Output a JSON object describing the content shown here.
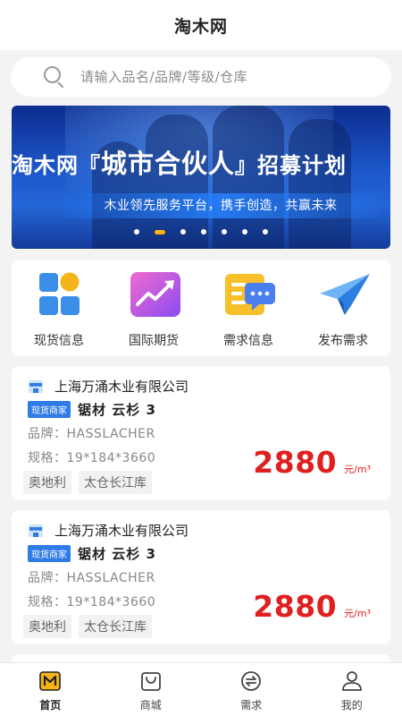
{
  "header": {
    "title": "淘木网"
  },
  "search": {
    "placeholder": "请输入品名/品牌/等级/仓库"
  },
  "banner": {
    "headline_a": "淘木网『",
    "headline_b": "城市合伙人",
    "headline_c": "』招募计划",
    "subline": "木业领先服务平台，携手创造，共赢未来",
    "slides": 7,
    "active_slide": 2
  },
  "menu": [
    {
      "label": "现货信息",
      "icon": "grid-icon"
    },
    {
      "label": "国际期货",
      "icon": "trend-chart-icon"
    },
    {
      "label": "需求信息",
      "icon": "message-card-icon"
    },
    {
      "label": "发布需求",
      "icon": "paper-plane-icon"
    }
  ],
  "listings": [
    {
      "company": "上海万涌木业有限公司",
      "tag": "现货商家",
      "product": "锯材 云杉 3",
      "brand": "品牌：HASSLACHER",
      "spec": "规格：19*184*3660",
      "origin": "奥地利",
      "warehouse": "太仓长江库",
      "price": "2880",
      "unit": "元/m³"
    },
    {
      "company": "上海万涌木业有限公司",
      "tag": "现货商家",
      "product": "锯材 云杉 3",
      "brand": "品牌：HASSLACHER",
      "spec": "规格：19*184*3660",
      "origin": "奥地利",
      "warehouse": "太仓长江库",
      "price": "2880",
      "unit": "元/m³"
    }
  ],
  "tabs": [
    {
      "label": "首页",
      "icon": "home-icon",
      "active": true
    },
    {
      "label": "商城",
      "icon": "shopping-bag-icon",
      "active": false
    },
    {
      "label": "需求",
      "icon": "exchange-icon",
      "active": false
    },
    {
      "label": "我的",
      "icon": "user-icon",
      "active": false
    }
  ],
  "colors": {
    "accent": "#2f7ce6",
    "price": "#e02020",
    "active_dot": "#ffb400"
  }
}
